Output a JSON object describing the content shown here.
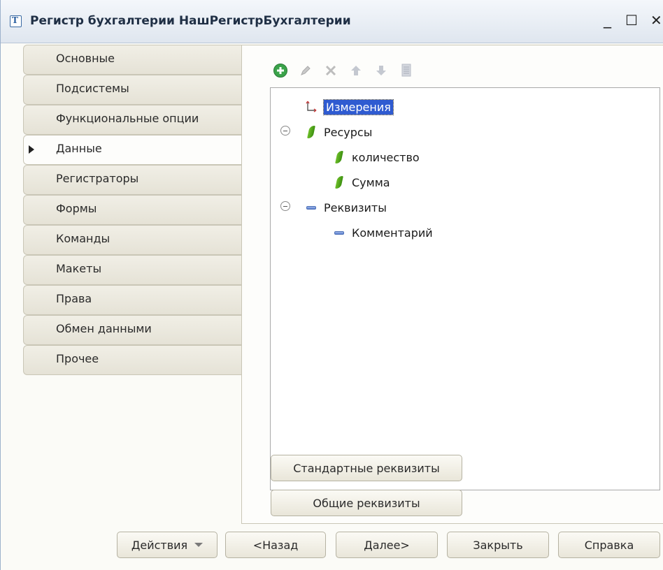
{
  "window": {
    "title": "Регистр бухгалтерии НашРегистрБухгалтерии",
    "icon_letter": "Т",
    "minimize": "_",
    "maximize": "☐",
    "close": "✕"
  },
  "tabs": [
    {
      "label": "Основные",
      "active": false
    },
    {
      "label": "Подсистемы",
      "active": false
    },
    {
      "label": "Функциональные опции",
      "active": false
    },
    {
      "label": "Данные",
      "active": true
    },
    {
      "label": "Регистраторы",
      "active": false
    },
    {
      "label": "Формы",
      "active": false
    },
    {
      "label": "Команды",
      "active": false
    },
    {
      "label": "Макеты",
      "active": false
    },
    {
      "label": "Права",
      "active": false
    },
    {
      "label": "Обмен данными",
      "active": false
    },
    {
      "label": "Прочее",
      "active": false
    }
  ],
  "toolbar": {
    "icons": [
      "add-icon",
      "edit-icon",
      "delete-icon",
      "move-up-icon",
      "move-down-icon",
      "sort-icon"
    ]
  },
  "tree": {
    "dimensions": {
      "label": "Измерения",
      "selected": true
    },
    "resources": {
      "label": "Ресурсы",
      "children": [
        "количество",
        "Сумма"
      ]
    },
    "attributes": {
      "label": "Реквизиты",
      "children": [
        "Комментарий"
      ]
    }
  },
  "panel_buttons": {
    "standard": "Стандартные реквизиты",
    "common": "Общие реквизиты"
  },
  "footer": {
    "actions": "Действия",
    "back": "<Назад",
    "next": "Далее>",
    "close": "Закрыть",
    "help": "Справка"
  },
  "colors": {
    "selection": "#2f5bd1",
    "add_icon": "#3aa34a",
    "resource_icon": "#4fa51c",
    "attribute_icon": "#5a7fcf"
  }
}
